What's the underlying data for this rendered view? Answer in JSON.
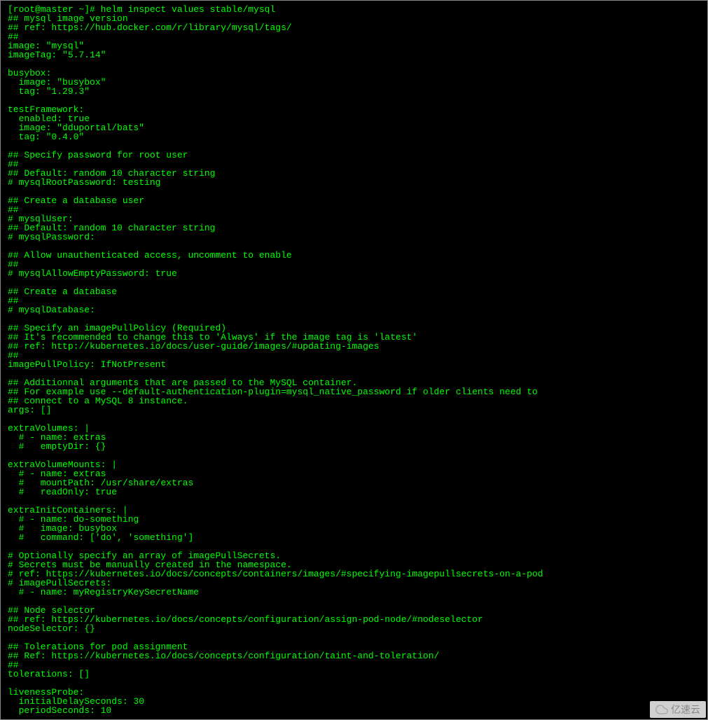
{
  "terminal": {
    "lines": [
      "[root@master ~]# helm inspect values stable/mysql",
      "## mysql image version",
      "## ref: https://hub.docker.com/r/library/mysql/tags/",
      "##",
      "image: \"mysql\"",
      "imageTag: \"5.7.14\"",
      "",
      "busybox:",
      "  image: \"busybox\"",
      "  tag: \"1.29.3\"",
      "",
      "testFramework:",
      "  enabled: true",
      "  image: \"dduportal/bats\"",
      "  tag: \"0.4.0\"",
      "",
      "## Specify password for root user",
      "##",
      "## Default: random 10 character string",
      "# mysqlRootPassword: testing",
      "",
      "## Create a database user",
      "##",
      "# mysqlUser:",
      "## Default: random 10 character string",
      "# mysqlPassword:",
      "",
      "## Allow unauthenticated access, uncomment to enable",
      "##",
      "# mysqlAllowEmptyPassword: true",
      "",
      "## Create a database",
      "##",
      "# mysqlDatabase:",
      "",
      "## Specify an imagePullPolicy (Required)",
      "## It's recommended to change this to 'Always' if the image tag is 'latest'",
      "## ref: http://kubernetes.io/docs/user-guide/images/#updating-images",
      "##",
      "imagePullPolicy: IfNotPresent",
      "",
      "## Additionnal arguments that are passed to the MySQL container.",
      "## For example use --default-authentication-plugin=mysql_native_password if older clients need to",
      "## connect to a MySQL 8 instance.",
      "args: []",
      "",
      "extraVolumes: |",
      "  # - name: extras",
      "  #   emptyDir: {}",
      "",
      "extraVolumeMounts: |",
      "  # - name: extras",
      "  #   mountPath: /usr/share/extras",
      "  #   readOnly: true",
      "",
      "extraInitContainers: |",
      "  # - name: do-something",
      "  #   image: busybox",
      "  #   command: ['do', 'something']",
      "",
      "# Optionally specify an array of imagePullSecrets.",
      "# Secrets must be manually created in the namespace.",
      "# ref: https://kubernetes.io/docs/concepts/containers/images/#specifying-imagepullsecrets-on-a-pod",
      "# imagePullSecrets:",
      "  # - name: myRegistryKeySecretName",
      "",
      "## Node selector",
      "## ref: https://kubernetes.io/docs/concepts/configuration/assign-pod-node/#nodeselector",
      "nodeSelector: {}",
      "",
      "## Tolerations for pod assignment",
      "## Ref: https://kubernetes.io/docs/concepts/configuration/taint-and-toleration/",
      "##",
      "tolerations: []",
      "",
      "livenessProbe:",
      "  initialDelaySeconds: 30",
      "  periodSeconds: 10"
    ]
  },
  "watermark": {
    "text": "亿速云"
  }
}
